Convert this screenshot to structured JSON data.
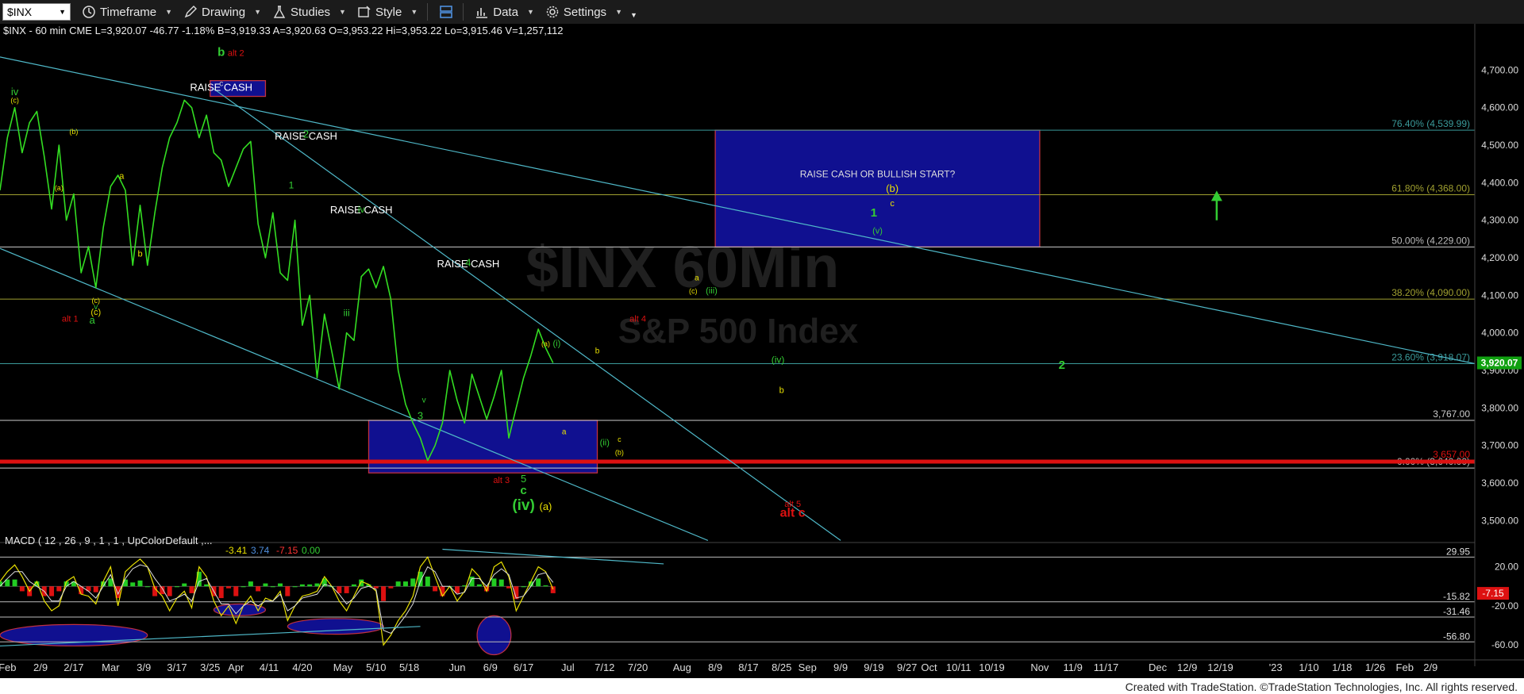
{
  "toolbar": {
    "symbol": "$INX",
    "timeframe": "Timeframe",
    "drawing": "Drawing",
    "studies": "Studies",
    "style": "Style",
    "data": "Data",
    "settings": "Settings"
  },
  "header": {
    "quote": "$INX - 60 min  CME   L=3,920.07  -46.77  -1.18%  B=3,919.33  A=3,920.63  O=3,953.22  Hi=3,953.22  Lo=3,915.46  V=1,257,112"
  },
  "watermark": {
    "line1": "$INX 60Min",
    "line2": "S&P 500 Index"
  },
  "colors": {
    "price": "#33dd22",
    "green": "#33cc33",
    "red": "#dd1111",
    "yellow": "#e8e000",
    "cyan": "#4fb8c8",
    "box": "#101090"
  },
  "chart_data": {
    "type": "line",
    "price_axis": {
      "ylim": [
        3450,
        4760
      ],
      "ticks": [
        "4,700.00",
        "4,600.00",
        "4,500.00",
        "4,400.00",
        "4,300.00",
        "4,200.00",
        "4,100.00",
        "4,000.00",
        "3,900.00",
        "3,800.00",
        "3,700.00",
        "3,600.00",
        "3,500.00"
      ],
      "tick_values": [
        4700,
        4600,
        4500,
        4400,
        4300,
        4200,
        4100,
        4000,
        3900,
        3800,
        3700,
        3600,
        3500
      ]
    },
    "last_price_tag": "3,920.07",
    "fib_levels": [
      {
        "label": "76.40% (4,539.99)",
        "value": 4539.99,
        "color": "#3a9a9a"
      },
      {
        "label": "61.80% (4,368.00)",
        "value": 4368.0,
        "color": "#a0a030"
      },
      {
        "label": "50.00% (4,229.00)",
        "value": 4229.0,
        "color": "#cccccc"
      },
      {
        "label": "38.20% (4,090.00)",
        "value": 4090.0,
        "color": "#a0a030"
      },
      {
        "label": "23.60% (3,918.07)",
        "value": 3918.07,
        "color": "#3a9a9a"
      },
      {
        "label": "0.00% (3,640.00)",
        "value": 3640.0,
        "color": "#cccccc"
      }
    ],
    "support_level": {
      "label": "3,767.00",
      "value": 3767
    },
    "red_level": {
      "label": "3,657.00",
      "value": 3657
    },
    "price_series": [
      {
        "x": 0,
        "y": 4380
      },
      {
        "x": 1,
        "y": 4520
      },
      {
        "x": 2,
        "y": 4600
      },
      {
        "x": 3,
        "y": 4480
      },
      {
        "x": 4,
        "y": 4560
      },
      {
        "x": 5,
        "y": 4590
      },
      {
        "x": 6,
        "y": 4470
      },
      {
        "x": 7,
        "y": 4330
      },
      {
        "x": 8,
        "y": 4500
      },
      {
        "x": 9,
        "y": 4300
      },
      {
        "x": 10,
        "y": 4370
      },
      {
        "x": 11,
        "y": 4160
      },
      {
        "x": 12,
        "y": 4230
      },
      {
        "x": 13,
        "y": 4120
      },
      {
        "x": 14,
        "y": 4280
      },
      {
        "x": 15,
        "y": 4390
      },
      {
        "x": 16,
        "y": 4420
      },
      {
        "x": 17,
        "y": 4380
      },
      {
        "x": 18,
        "y": 4180
      },
      {
        "x": 19,
        "y": 4340
      },
      {
        "x": 20,
        "y": 4180
      },
      {
        "x": 21,
        "y": 4320
      },
      {
        "x": 22,
        "y": 4440
      },
      {
        "x": 23,
        "y": 4520
      },
      {
        "x": 24,
        "y": 4560
      },
      {
        "x": 25,
        "y": 4620
      },
      {
        "x": 26,
        "y": 4600
      },
      {
        "x": 27,
        "y": 4520
      },
      {
        "x": 28,
        "y": 4580
      },
      {
        "x": 29,
        "y": 4480
      },
      {
        "x": 30,
        "y": 4460
      },
      {
        "x": 31,
        "y": 4390
      },
      {
        "x": 32,
        "y": 4440
      },
      {
        "x": 33,
        "y": 4490
      },
      {
        "x": 34,
        "y": 4510
      },
      {
        "x": 35,
        "y": 4290
      },
      {
        "x": 36,
        "y": 4200
      },
      {
        "x": 37,
        "y": 4320
      },
      {
        "x": 38,
        "y": 4160
      },
      {
        "x": 39,
        "y": 4140
      },
      {
        "x": 40,
        "y": 4300
      },
      {
        "x": 41,
        "y": 4020
      },
      {
        "x": 42,
        "y": 4100
      },
      {
        "x": 43,
        "y": 3880
      },
      {
        "x": 44,
        "y": 4050
      },
      {
        "x": 45,
        "y": 3950
      },
      {
        "x": 46,
        "y": 3850
      },
      {
        "x": 47,
        "y": 4000
      },
      {
        "x": 48,
        "y": 3980
      },
      {
        "x": 49,
        "y": 4150
      },
      {
        "x": 50,
        "y": 4170
      },
      {
        "x": 51,
        "y": 4120
      },
      {
        "x": 52,
        "y": 4177
      },
      {
        "x": 53,
        "y": 4090
      },
      {
        "x": 54,
        "y": 3900
      },
      {
        "x": 55,
        "y": 3810
      },
      {
        "x": 56,
        "y": 3760
      },
      {
        "x": 57,
        "y": 3720
      },
      {
        "x": 58,
        "y": 3660
      },
      {
        "x": 59,
        "y": 3700
      },
      {
        "x": 60,
        "y": 3760
      },
      {
        "x": 61,
        "y": 3900
      },
      {
        "x": 62,
        "y": 3820
      },
      {
        "x": 63,
        "y": 3760
      },
      {
        "x": 64,
        "y": 3890
      },
      {
        "x": 65,
        "y": 3830
      },
      {
        "x": 66,
        "y": 3770
      },
      {
        "x": 67,
        "y": 3830
      },
      {
        "x": 68,
        "y": 3900
      },
      {
        "x": 69,
        "y": 3720
      },
      {
        "x": 70,
        "y": 3800
      },
      {
        "x": 71,
        "y": 3880
      },
      {
        "x": 72,
        "y": 3940
      },
      {
        "x": 73,
        "y": 4010
      },
      {
        "x": 74,
        "y": 3960
      },
      {
        "x": 75,
        "y": 3920
      }
    ],
    "x_range": [
      0,
      200
    ],
    "boxes": [
      {
        "x0": 97,
        "x1": 141,
        "y0": 4229,
        "y1": 4540,
        "label": "RAISE CASH OR BULLISH START?"
      },
      {
        "x0": 50,
        "x1": 81,
        "y0": 3627,
        "y1": 3767,
        "label": ""
      },
      {
        "x0": 28.5,
        "x1": 36,
        "y0": 4630,
        "y1": 4672,
        "label": ""
      }
    ],
    "trendlines": [
      {
        "x0": 0,
        "y0": 4735,
        "x1": 200,
        "y1": 3918
      },
      {
        "x0": 0,
        "y0": 4225,
        "x1": 96,
        "y1": 3447
      },
      {
        "x0": 29,
        "y0": 4650,
        "x1": 114,
        "y1": 3447
      }
    ],
    "annotations": [
      {
        "text": "RAISE CASH",
        "x": 30,
        "y": 4645,
        "color": "#ffffff",
        "size": 13
      },
      {
        "text": "RAISE CASH",
        "x": 41.5,
        "y": 4515,
        "color": "#ffffff",
        "size": 13
      },
      {
        "text": "RAISE CASH",
        "x": 49,
        "y": 4318,
        "color": "#ffffff",
        "size": 13
      },
      {
        "text": "RAISE CASH",
        "x": 63.5,
        "y": 4175,
        "color": "#ffffff",
        "size": 13
      },
      {
        "text": "b",
        "x": 30,
        "y": 4738,
        "color": "#33cc33",
        "size": 15
      },
      {
        "text": "alt 2",
        "x": 32,
        "y": 4738,
        "color": "#dd1111",
        "size": 11
      },
      {
        "text": "c",
        "x": 30,
        "y": 4658,
        "color": "#cccccc",
        "size": 10
      },
      {
        "text": "iv",
        "x": 2,
        "y": 4633,
        "color": "#33cc33",
        "size": 13
      },
      {
        "text": "(c)",
        "x": 2,
        "y": 4613,
        "color": "#e8e000",
        "size": 9
      },
      {
        "text": "(b)",
        "x": 10,
        "y": 4530,
        "color": "#e8e000",
        "size": 9
      },
      {
        "text": "(a)",
        "x": 8,
        "y": 4380,
        "color": "#e8e000",
        "size": 9
      },
      {
        "text": "a",
        "x": 16.5,
        "y": 4410,
        "color": "#e8e000",
        "size": 11
      },
      {
        "text": "b",
        "x": 19,
        "y": 4203,
        "color": "#e8e000",
        "size": 11
      },
      {
        "text": "(c)",
        "x": 13,
        "y": 4080,
        "color": "#e8e000",
        "size": 9
      },
      {
        "text": "v",
        "x": 13,
        "y": 4063,
        "color": "#33cc33",
        "size": 10
      },
      {
        "text": "(c)",
        "x": 13,
        "y": 4048,
        "color": "#e8e000",
        "size": 11
      },
      {
        "text": "a",
        "x": 12.5,
        "y": 4025,
        "color": "#33cc33",
        "size": 13
      },
      {
        "text": "alt 1",
        "x": 9.5,
        "y": 4030,
        "color": "#dd1111",
        "size": 11
      },
      {
        "text": "2",
        "x": 41.5,
        "y": 4520,
        "color": "#33cc33",
        "size": 13
      },
      {
        "text": "1",
        "x": 39.5,
        "y": 4385,
        "color": "#33cc33",
        "size": 12
      },
      {
        "text": "iv",
        "x": 49,
        "y": 4320,
        "color": "#33cc33",
        "size": 12
      },
      {
        "text": "iii",
        "x": 47,
        "y": 4045,
        "color": "#33cc33",
        "size": 12
      },
      {
        "text": "v",
        "x": 57.5,
        "y": 3815,
        "color": "#33cc33",
        "size": 10
      },
      {
        "text": "3",
        "x": 57,
        "y": 3770,
        "color": "#33cc33",
        "size": 13
      },
      {
        "text": "4",
        "x": 63.5,
        "y": 4178,
        "color": "#33cc33",
        "size": 13
      },
      {
        "text": "alt 3",
        "x": 68,
        "y": 3600,
        "color": "#dd1111",
        "size": 11
      },
      {
        "text": "5",
        "x": 71,
        "y": 3602,
        "color": "#33cc33",
        "size": 13
      },
      {
        "text": "c",
        "x": 71,
        "y": 3570,
        "color": "#33cc33",
        "size": 15
      },
      {
        "text": "(iv)",
        "x": 71,
        "y": 3528,
        "color": "#33cc33",
        "size": 19
      },
      {
        "text": "(a)",
        "x": 74,
        "y": 3528,
        "color": "#e8e000",
        "size": 13
      },
      {
        "text": "(a)",
        "x": 74,
        "y": 3965,
        "color": "#e8e000",
        "size": 9
      },
      {
        "text": "(i)",
        "x": 75.5,
        "y": 3965,
        "color": "#33cc33",
        "size": 11
      },
      {
        "text": "a",
        "x": 76.5,
        "y": 3730,
        "color": "#e8e000",
        "size": 10
      },
      {
        "text": "b",
        "x": 81,
        "y": 3945,
        "color": "#e8e000",
        "size": 10
      },
      {
        "text": "(ii)",
        "x": 82,
        "y": 3700,
        "color": "#33cc33",
        "size": 11
      },
      {
        "text": "c",
        "x": 84,
        "y": 3710,
        "color": "#e8e000",
        "size": 9
      },
      {
        "text": "(b)",
        "x": 84,
        "y": 3675,
        "color": "#e8e000",
        "size": 9
      },
      {
        "text": "alt 4",
        "x": 86.5,
        "y": 4030,
        "color": "#dd1111",
        "size": 11
      },
      {
        "text": "a",
        "x": 94.5,
        "y": 4140,
        "color": "#e8e000",
        "size": 10
      },
      {
        "text": "(c)",
        "x": 94,
        "y": 4105,
        "color": "#e8e000",
        "size": 9
      },
      {
        "text": "(iii)",
        "x": 96.5,
        "y": 4105,
        "color": "#33cc33",
        "size": 11
      },
      {
        "text": "(iv)",
        "x": 105.5,
        "y": 3920,
        "color": "#33cc33",
        "size": 12
      },
      {
        "text": "b",
        "x": 106,
        "y": 3840,
        "color": "#e8e000",
        "size": 11
      },
      {
        "text": "(b)",
        "x": 121,
        "y": 4375,
        "color": "#e8e000",
        "size": 13
      },
      {
        "text": "c",
        "x": 121,
        "y": 4337,
        "color": "#e8e000",
        "size": 11
      },
      {
        "text": "1",
        "x": 118.5,
        "y": 4310,
        "color": "#33cc33",
        "size": 15
      },
      {
        "text": "(v)",
        "x": 119,
        "y": 4265,
        "color": "#33cc33",
        "size": 11
      },
      {
        "text": "2",
        "x": 144,
        "y": 3904,
        "color": "#33cc33",
        "size": 15
      },
      {
        "text": "alt 5",
        "x": 107.5,
        "y": 3537,
        "color": "#dd1111",
        "size": 11
      },
      {
        "text": "alt c",
        "x": 107.5,
        "y": 3510,
        "color": "#dd1111",
        "size": 16
      }
    ],
    "arrow": {
      "x": 165,
      "y0": 4300,
      "y1": 4360,
      "color": "#33cc33"
    },
    "x_ticks": [
      "Feb",
      "2/9",
      "2/17",
      "Mar",
      "3/9",
      "3/17",
      "3/25",
      "Apr",
      "4/11",
      "4/20",
      "May",
      "5/10",
      "5/18",
      "Jun",
      "6/9",
      "6/17",
      "Jul",
      "7/12",
      "7/20",
      "Aug",
      "8/9",
      "8/17",
      "8/25",
      "Sep",
      "9/9",
      "9/19",
      "9/27",
      "Oct",
      "10/11",
      "10/19",
      "Nov",
      "11/9",
      "11/17",
      "Dec",
      "12/9",
      "12/19",
      "'23",
      "1/10",
      "1/18",
      "1/26",
      "Feb",
      "2/9"
    ],
    "x_tick_positions": [
      1,
      5.5,
      10,
      15,
      19.5,
      24,
      28.5,
      32,
      36.5,
      41,
      46.5,
      51,
      55.5,
      62,
      66.5,
      71,
      77,
      82,
      86.5,
      92.5,
      97,
      101.5,
      106,
      109.5,
      114,
      118.5,
      123,
      126,
      130,
      134.5,
      141,
      145.5,
      150,
      157,
      161,
      165.5,
      173,
      177.5,
      182,
      186.5,
      190.5,
      194
    ],
    "macd": {
      "title": "MACD ( 12 , 26 , 9 , 1 , 1 , UpColorDefault ,...",
      "values_text": [
        "-3.41",
        "3.74",
        "-7.15",
        "0.00"
      ],
      "values_colors": [
        "#e8e000",
        "#4f8fdd",
        "#ff3333",
        "#33cc33"
      ],
      "ylim": [
        -72,
        40
      ],
      "levels": [
        {
          "label": "29.95",
          "value": 29.95
        },
        {
          "label": "-15.82",
          "value": -15.82
        },
        {
          "label": "-31.46",
          "value": -31.46
        },
        {
          "label": "-56.80",
          "value": -56.8
        }
      ],
      "ticks": [
        "20.00",
        "-20.00",
        "-60.00"
      ],
      "tick_values": [
        20,
        -20,
        -60
      ],
      "last_tag": "-7.15",
      "macd_line": [
        5,
        15,
        22,
        10,
        -5,
        5,
        -15,
        -25,
        -20,
        5,
        10,
        -8,
        -10,
        -18,
        5,
        20,
        -20,
        15,
        22,
        28,
        20,
        -2,
        -10,
        -25,
        -12,
        -5,
        -22,
        20,
        10,
        -15,
        -30,
        -20,
        -38,
        -20,
        -10,
        -25,
        -12,
        -15,
        -5,
        -35,
        -20,
        -10,
        -8,
        -5,
        10,
        0,
        -15,
        -25,
        -10,
        5,
        2,
        -5,
        -60,
        -50,
        -35,
        -25,
        -10,
        20,
        30,
        10,
        -10,
        0,
        -15,
        -5,
        18,
        10,
        -5,
        20,
        25,
        10,
        -25,
        -10,
        5,
        20,
        15,
        -3
      ],
      "signal_line": [
        0,
        8,
        15,
        15,
        5,
        0,
        -5,
        -15,
        -15,
        0,
        5,
        0,
        -5,
        -12,
        0,
        12,
        -8,
        8,
        18,
        22,
        20,
        8,
        -2,
        -15,
        -12,
        -8,
        -15,
        5,
        8,
        -5,
        -18,
        -18,
        -28,
        -20,
        -15,
        -20,
        -15,
        -15,
        -8,
        -25,
        -20,
        -12,
        -10,
        -8,
        2,
        0,
        -8,
        -18,
        -12,
        -2,
        0,
        -3,
        -45,
        -48,
        -40,
        -30,
        -18,
        5,
        20,
        15,
        0,
        0,
        -8,
        -6,
        8,
        8,
        0,
        12,
        18,
        12,
        -12,
        -10,
        0,
        12,
        14,
        4
      ],
      "ellipses": [
        {
          "cx": 10,
          "cy": -50,
          "rx": 10,
          "ry": 11
        },
        {
          "cx": 32.5,
          "cy": -24,
          "rx": 3.5,
          "ry": 6
        },
        {
          "cx": 45.5,
          "cy": -41,
          "rx": 6.5,
          "ry": 8
        },
        {
          "cx": 67,
          "cy": -50,
          "rx": 2.3,
          "ry": 20
        }
      ],
      "trendlines": [
        {
          "x0": 0,
          "y0": -61,
          "x1": 57,
          "y1": -41
        },
        {
          "x0": 60,
          "y0": 38,
          "x1": 90,
          "y1": 23
        }
      ]
    }
  },
  "footer": "Created with TradeStation. ©TradeStation Technologies, Inc. All rights reserved."
}
